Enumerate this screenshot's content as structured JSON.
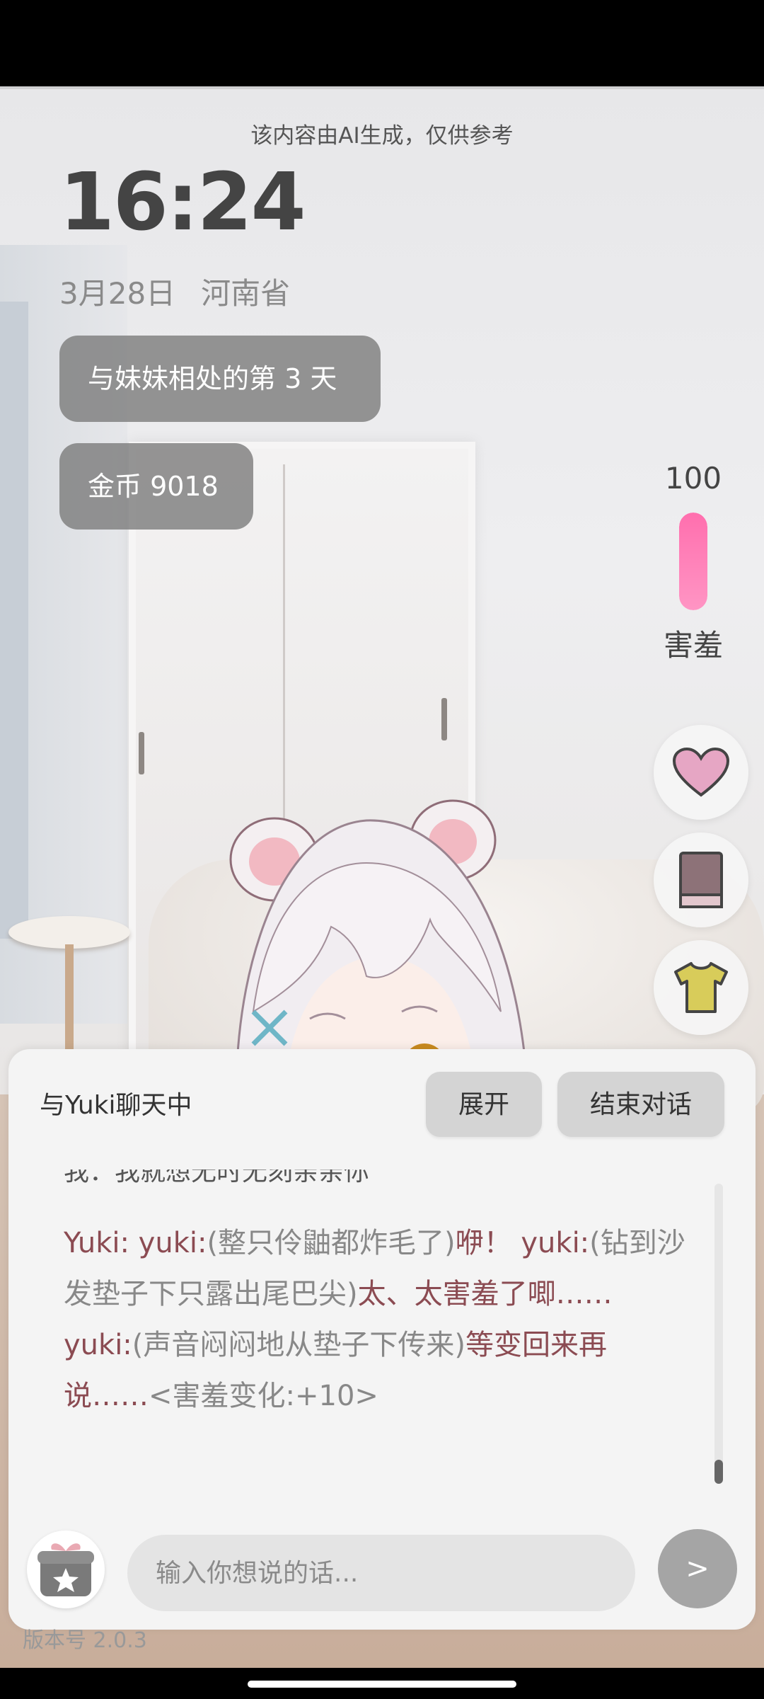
{
  "notice": "该内容由AI生成，仅供参考",
  "clock": "16:24",
  "date": "3月28日",
  "location": "河南省",
  "days_badge": "与妹妹相处的第 3 天",
  "coins_badge": "金币 9018",
  "meter": {
    "value": "100",
    "label": "害羞",
    "fill_fraction": 1.0,
    "color": "#ff78b3"
  },
  "side_buttons": [
    {
      "icon": "heart-icon"
    },
    {
      "icon": "book-icon"
    },
    {
      "icon": "shirt-icon"
    }
  ],
  "chat": {
    "title": "与Yuki聊天中",
    "expand_label": "展开",
    "end_label": "结束对话",
    "my_message": "我：我就想无时无刻亲亲你",
    "yuki_message": {
      "prefix": "Yuki: yuki:",
      "p1_gray": "(整只伶鼬都炸毛了)",
      "p1_red": "咿！ yuki:",
      "p2_gray": "(钻到沙发垫子下只露出尾巴尖)",
      "p2_red": "太、太害羞了唧…… yuki:",
      "p3_gray": "(声音闷闷地从垫子下传来)",
      "p3_red": "等变回来再说……",
      "change": "<害羞变化:+10>"
    },
    "input_placeholder": "输入你想说的话...",
    "send_label": ">",
    "version_label": "版本号 2.0.3"
  }
}
